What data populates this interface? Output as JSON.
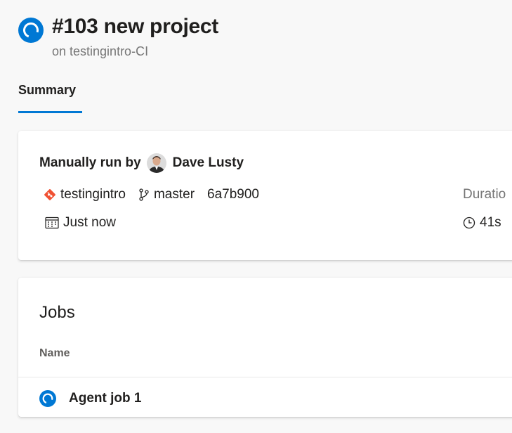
{
  "run": {
    "title": "#103 new project",
    "pipeline": "on testingintro-CI",
    "status_icon": "run-in-progress-icon"
  },
  "tabs": [
    {
      "label": "Summary",
      "selected": true
    }
  ],
  "summary": {
    "trigger_label": "Manually run by",
    "user_name": "Dave Lusty",
    "repository": "testingintro",
    "branch": "master",
    "commit": "6a7b900",
    "when": "Just now",
    "duration_label": "Duratio",
    "duration_value": "41s"
  },
  "jobs": {
    "title": "Jobs",
    "columns": [
      "Name"
    ],
    "rows": [
      {
        "name": "Agent job 1",
        "status_icon": "run-in-progress-icon"
      }
    ]
  },
  "colors": {
    "accent": "#0078d4",
    "git_orange": "#f05133",
    "background": "#f8f8f8",
    "card": "#ffffff"
  }
}
